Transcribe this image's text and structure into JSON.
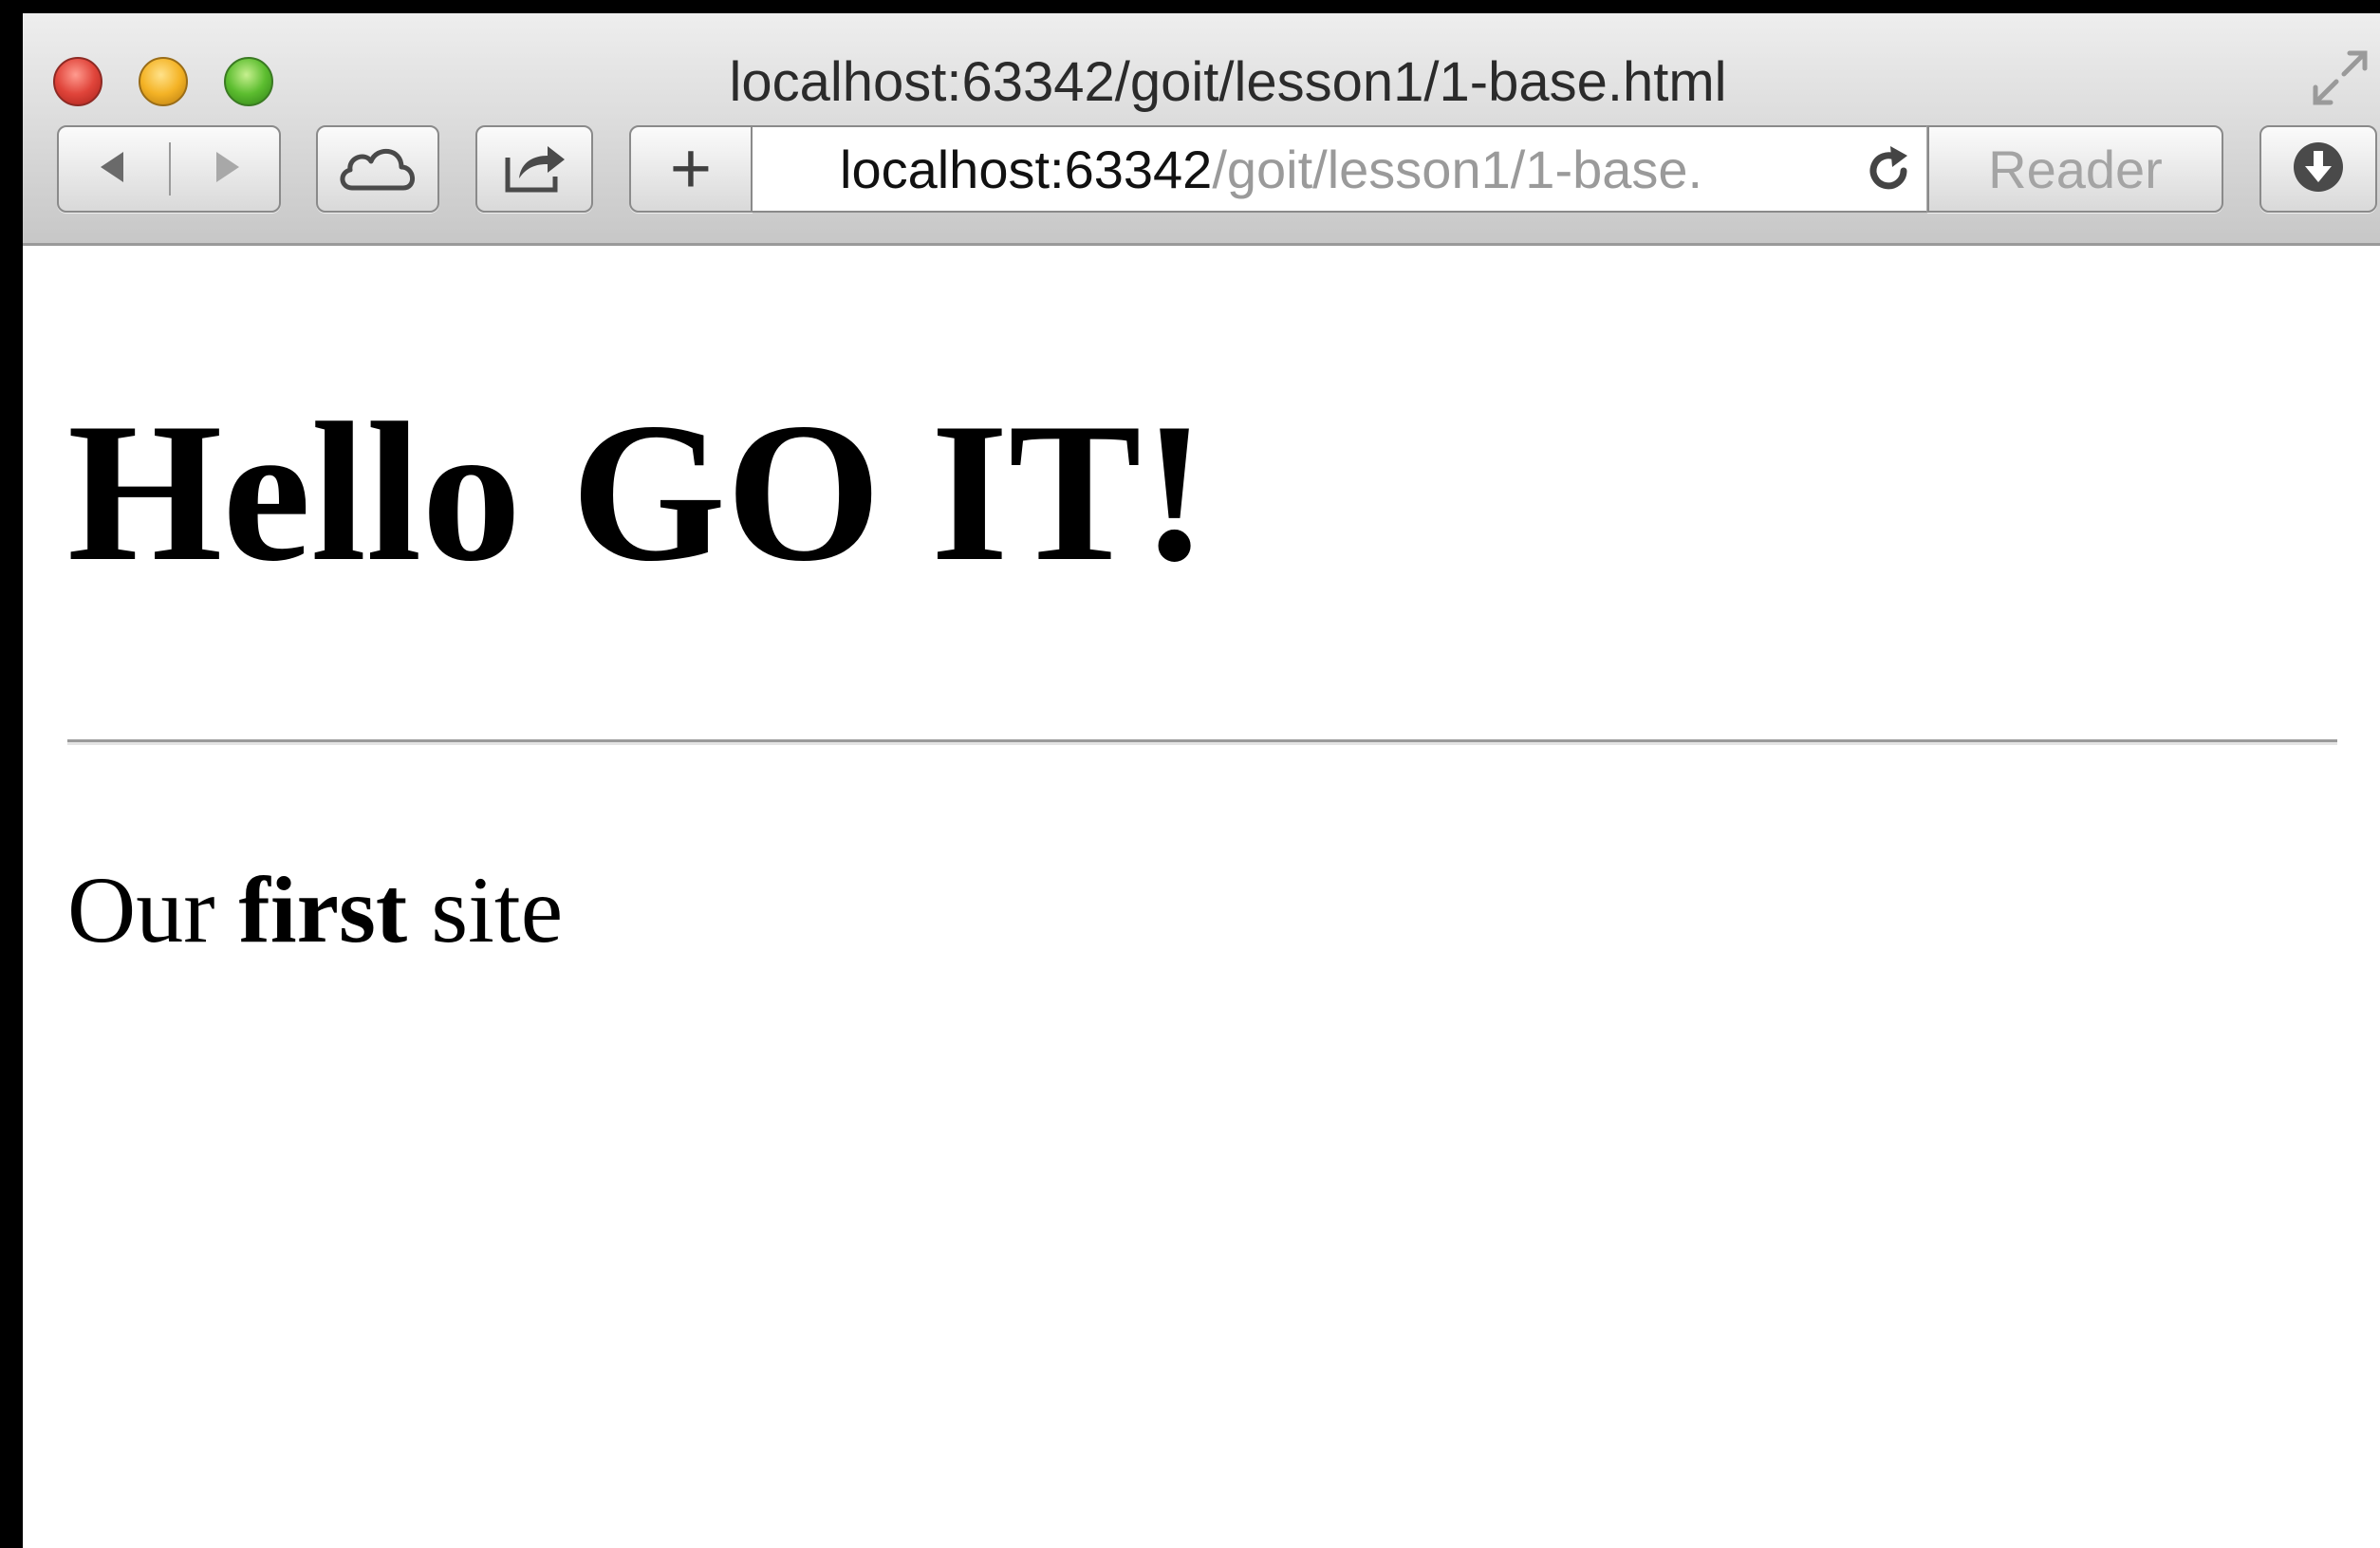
{
  "window": {
    "title": "localhost:63342/goit/lesson1/1-base.html",
    "traffic_lights": [
      "close",
      "minimize",
      "zoom"
    ]
  },
  "toolbar": {
    "back_icon": "back-arrow-icon",
    "forward_icon": "forward-arrow-icon",
    "icloud_icon": "cloud-icon",
    "share_icon": "share-icon",
    "new_tab_label": "+",
    "address": {
      "host": "localhost:63342",
      "path": "/goit/lesson1/1-base."
    },
    "reload_icon": "reload-icon",
    "reader_label": "Reader",
    "downloads_icon": "download-icon"
  },
  "page": {
    "heading": "Hello GO IT!",
    "paragraph": {
      "before": "Our ",
      "bold": "first",
      "after": " site"
    }
  },
  "colors": {
    "close": "#e0443a",
    "minimize": "#f4b326",
    "zoom": "#5cbd2f",
    "url_path": "#9a9a9a",
    "reader": "#a4a4a4"
  }
}
